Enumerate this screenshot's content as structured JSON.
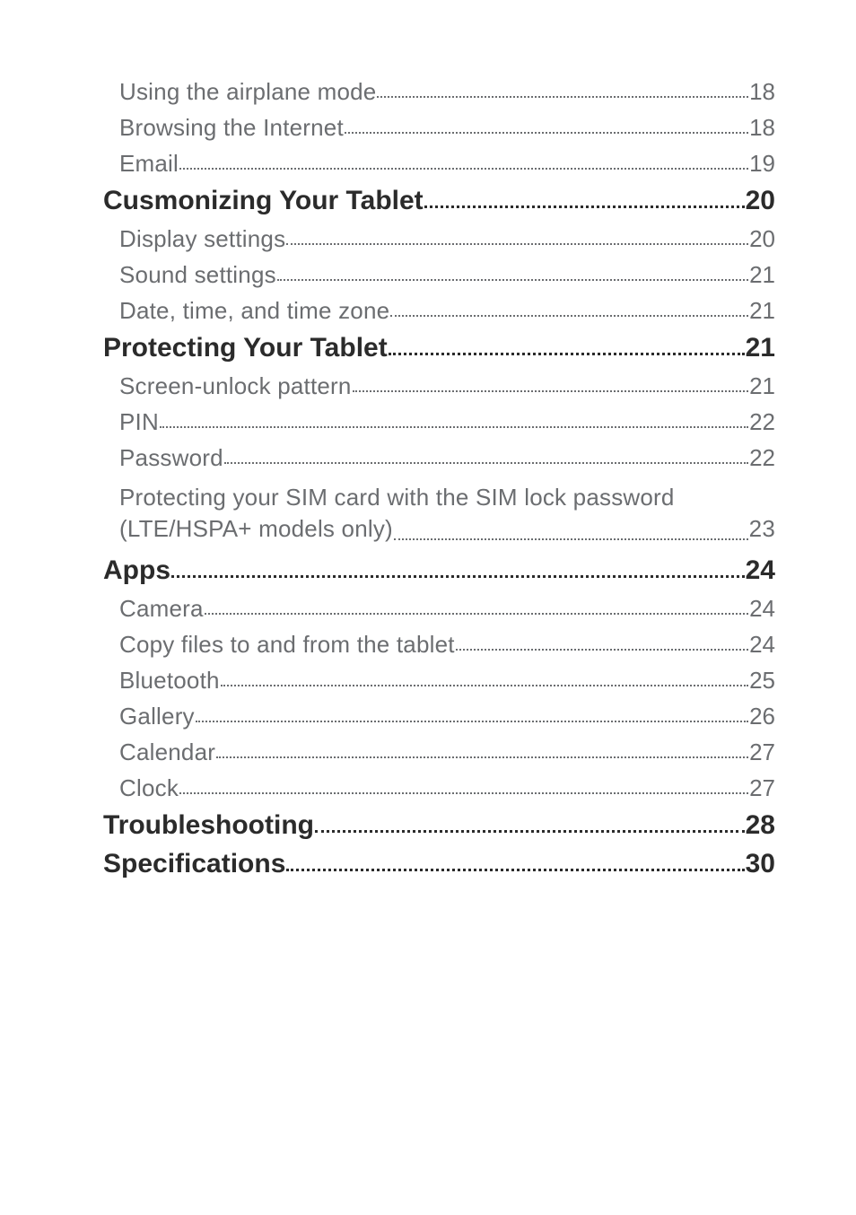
{
  "toc": [
    {
      "type": "sub",
      "label": "Using the airplane mode",
      "page": "18"
    },
    {
      "type": "sub",
      "label": "Browsing the Internet",
      "page": "18"
    },
    {
      "type": "sub",
      "label": "Email",
      "page": "19"
    },
    {
      "type": "head",
      "label": "Cusmonizing Your Tablet",
      "page": "20"
    },
    {
      "type": "sub",
      "label": "Display settings",
      "page": "20"
    },
    {
      "type": "sub",
      "label": "Sound settings",
      "page": "21"
    },
    {
      "type": "sub",
      "label": "Date, time, and time zone",
      "page": "21"
    },
    {
      "type": "head",
      "label": "Protecting Your Tablet",
      "page": "21"
    },
    {
      "type": "sub",
      "label": "Screen-unlock pattern",
      "page": "21"
    },
    {
      "type": "sub",
      "label": "PIN",
      "page": "22"
    },
    {
      "type": "sub",
      "label": "Password",
      "page": "22"
    },
    {
      "type": "multi",
      "line1": "Protecting your SIM card with the SIM lock password",
      "line2": "(LTE/HSPA+ models only)",
      "page": "23"
    },
    {
      "type": "head",
      "label": "Apps",
      "page": "24"
    },
    {
      "type": "sub",
      "label": "Camera",
      "page": "24"
    },
    {
      "type": "sub",
      "label": "Copy files to and from the tablet",
      "page": "24"
    },
    {
      "type": "sub",
      "label": "Bluetooth",
      "page": "25"
    },
    {
      "type": "sub",
      "label": "Gallery",
      "page": "26"
    },
    {
      "type": "sub",
      "label": "Calendar",
      "page": "27"
    },
    {
      "type": "sub",
      "label": "Clock",
      "page": "27"
    },
    {
      "type": "head",
      "label": "Troubleshooting",
      "page": "28"
    },
    {
      "type": "head",
      "label": "Specifications",
      "page": "30"
    }
  ]
}
